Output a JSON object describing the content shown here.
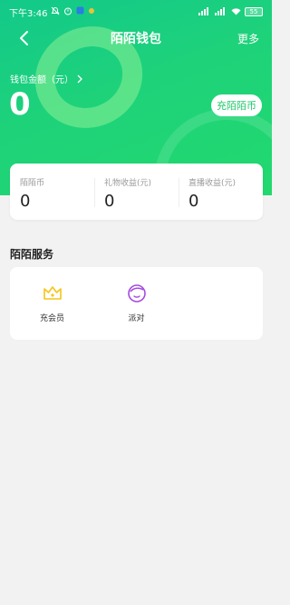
{
  "status_bar": {
    "time": "下午3:46",
    "battery": "55"
  },
  "header": {
    "title": "陌陌钱包",
    "more_label": "更多"
  },
  "wallet": {
    "label": "钱包金额（元）",
    "amount": "0",
    "recharge_label": "充陌陌币"
  },
  "stats": [
    {
      "label": "陌陌币",
      "value": "0"
    },
    {
      "label": "礼物收益(元)",
      "value": "0"
    },
    {
      "label": "直播收益(元)",
      "value": "0"
    }
  ],
  "services": {
    "title": "陌陌服务",
    "items": [
      {
        "label": "充会员",
        "icon": "crown-icon",
        "color": "#f5c518"
      },
      {
        "label": "派对",
        "icon": "party-face-icon",
        "color": "#a64be0"
      }
    ]
  },
  "colors": {
    "accent": "#1ec86a",
    "header_start": "#12c98a",
    "header_end": "#22d96e"
  }
}
